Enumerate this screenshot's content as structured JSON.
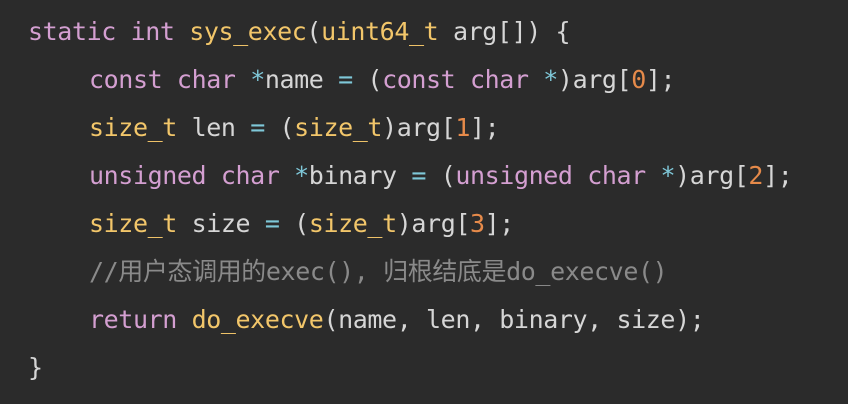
{
  "code": {
    "l1": {
      "static": "static",
      "int": "int",
      "fn_name": "sys_exec",
      "open_paren": "(",
      "param_type": "uint64_t",
      "param": "arg",
      "brackets": "[]",
      "close": ") {"
    },
    "l2": {
      "const1": "const",
      "char1": "char",
      "star1": "*",
      "var": "name",
      "eq": "=",
      "open": "(",
      "const2": "const",
      "char2": "char",
      "star2": "*",
      "close": ")",
      "arr": "arg[",
      "idx": "0",
      "end": "];"
    },
    "l3": {
      "type1": "size_t",
      "var": "len",
      "eq": "=",
      "open": "(",
      "type2": "size_t",
      "close": ")",
      "arr": "arg[",
      "idx": "1",
      "end": "];"
    },
    "l4": {
      "unsigned1": "unsigned",
      "char1": "char",
      "star1": "*",
      "var": "binary",
      "eq": "=",
      "open": "(",
      "unsigned2": "unsigned",
      "char2": "char",
      "star2": "*",
      "close": ")",
      "arr": "arg[",
      "idx": "2",
      "end": "];"
    },
    "l5": {
      "type1": "size_t",
      "var": "size",
      "eq": "=",
      "open": "(",
      "type2": "size_t",
      "close": ")",
      "arr": "arg[",
      "idx": "3",
      "end": "];"
    },
    "l6": {
      "comment": "//用户态调用的exec(), 归根结底是do_execve()"
    },
    "l7": {
      "return": "return",
      "fn_name": "do_execve",
      "args": "(name, len, binary, size);"
    },
    "l8": {
      "brace": "}"
    }
  },
  "colors": {
    "background": "#2b2b2b",
    "keyword": "#d49fd1",
    "type": "#f2c66a",
    "number": "#e68a4a",
    "operator": "#7fc8d9",
    "text": "#d6d6d6",
    "comment": "#8a8a8a"
  }
}
